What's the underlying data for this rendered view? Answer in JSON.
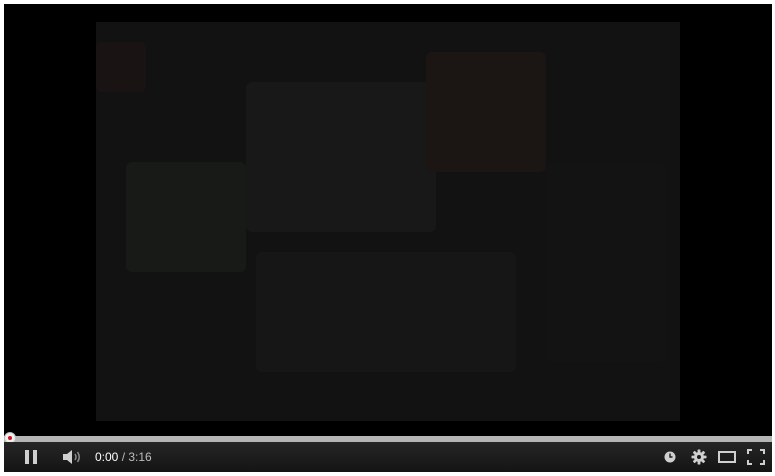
{
  "player": {
    "current_time": "0:00",
    "separator": " / ",
    "duration": "3:16",
    "progress_fraction": 0.0,
    "accent_color": "#cc181e",
    "controls": {
      "play_pause": "pause-icon",
      "volume": "volume-icon",
      "watch_later": "clock-icon",
      "settings": "gear-icon",
      "theater": "theater-mode-icon",
      "fullscreen": "fullscreen-icon"
    }
  }
}
